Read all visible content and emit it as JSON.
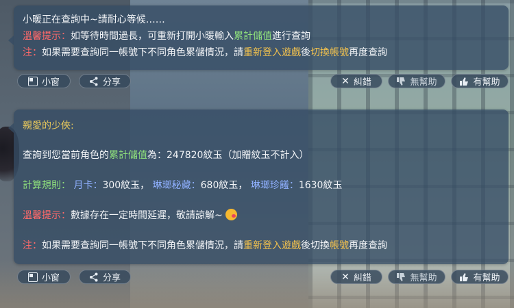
{
  "bubble1": {
    "line1": "小暖正在查詢中~請耐心等候……",
    "tip_label": "溫馨提示：",
    "tip_a": "如等待時間過長，可重新打開小暖輸入",
    "tip_highlight": "累計儲值",
    "tip_b": "進行查詢",
    "note_label": "注：",
    "note_a": "如果需要查詢同一帳號下不同角色累儲情況，請",
    "note_relogin": "重新登入遊戲",
    "note_b": "後",
    "note_switch": "切換帳號",
    "note_c": "再度查詢"
  },
  "bubble2": {
    "greeting": "親愛的少俠:",
    "query_a": "查詢到您當前角色的",
    "query_highlight": "累計儲值",
    "query_b": "為：247820紋玉（加贈紋玉不計入）",
    "rule_label": "計算規則：",
    "rule_monthcard_label": "月卡：",
    "rule_monthcard_value": "300紋玉，",
    "rule_treasure_label": "琳瑯秘藏：",
    "rule_treasure_value": "680紋玉，",
    "rule_gem_label": "琳瑯珍饈：",
    "rule_gem_value": "1630紋玉",
    "tip_label": "溫馨提示：",
    "tip_text": "數據存在一定時間延遲，敬請諒解~",
    "note_label": "注：",
    "note_a": "如果需要查詢同一帳號下不同角色累儲情況，請",
    "note_relogin": "重新登入遊戲",
    "note_b": "後切換",
    "note_switch": "帳號",
    "note_c": "再度查詢"
  },
  "actions": {
    "small_window": "小窗",
    "share": "分享",
    "report_error": "糾錯",
    "not_helpful": "無幫助",
    "helpful": "有幫助"
  },
  "colors": {
    "bubble_bg": "#344c64",
    "tip_red": "#ff6a6a",
    "highlight_green": "#8fe07c",
    "highlight_orange": "#f0c04e",
    "rule_blue": "#8fb0ff"
  },
  "icons": {
    "small_window": "window-icon",
    "share": "share-icon",
    "report_error": "close-icon",
    "not_helpful": "thumbs-down-icon",
    "helpful": "thumbs-up-icon",
    "emoji": "kiss-emoji-icon"
  }
}
